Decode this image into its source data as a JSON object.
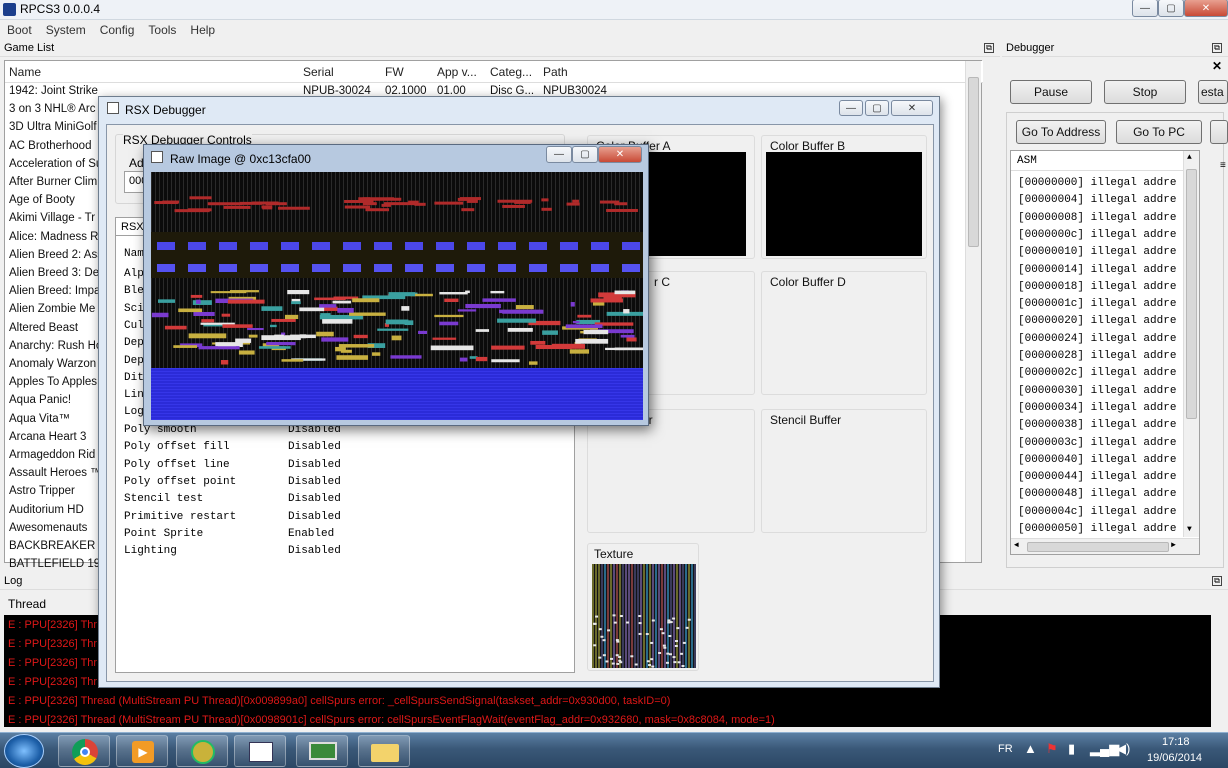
{
  "window": {
    "title": "RPCS3 0.0.0.4"
  },
  "menu": [
    "Boot",
    "System",
    "Config",
    "Tools",
    "Help"
  ],
  "game_list": {
    "title": "Game List",
    "columns": [
      "Name",
      "Serial",
      "FW",
      "App v...",
      "Categ...",
      "Path"
    ],
    "first_row": {
      "serial": "NPUB-30024",
      "fw": "02.1000",
      "app": "01.00",
      "category": "Disc G...",
      "path": "NPUB30024"
    },
    "names": [
      "1942: Joint Strike",
      "3 on 3 NHL® Arc",
      "3D Ultra MiniGolf",
      "AC Brotherhood",
      "Acceleration of Su",
      "After Burner Clim",
      "Age of Booty",
      "Akimi Village - Tr",
      "Alice: Madness R",
      "Alien Breed 2: Ass",
      "Alien Breed 3: De",
      "Alien Breed: Impa",
      "Alien Zombie Me",
      "Altered Beast",
      "Anarchy: Rush Ho",
      "Anomaly Warzon",
      "Apples To Apples",
      "Aqua Panic!",
      "Aqua Vita™",
      "Arcana Heart 3",
      "Armageddon Rid",
      "Assault Heroes ™",
      "Astro Tripper",
      "Auditorium HD",
      "Awesomenauts",
      "BACKBREAKER VE",
      "BATTLEFIELD 194"
    ]
  },
  "debugger": {
    "title": "Debugger",
    "pause": "Pause",
    "stop": "Stop",
    "third_button": "esta",
    "go_to_address": "Go To Address",
    "go_to_pc": "Go To PC",
    "asm_header": "ASM",
    "asm_lines": [
      "[00000000] illegal addre",
      "[00000004] illegal addre",
      "[00000008] illegal addre",
      "[0000000c] illegal addre",
      "[00000010] illegal addre",
      "[00000014] illegal addre",
      "[00000018] illegal addre",
      "[0000001c] illegal addre",
      "[00000020] illegal addre",
      "[00000024] illegal addre",
      "[00000028] illegal addre",
      "[0000002c] illegal addre",
      "[00000030] illegal addre",
      "[00000034] illegal addre",
      "[00000038] illegal addre",
      "[0000003c] illegal addre",
      "[00000040] illegal addre",
      "[00000044] illegal addre",
      "[00000048] illegal addre",
      "[0000004c] illegal addre",
      "[00000050] illegal addre"
    ]
  },
  "log": {
    "title": "Log",
    "column": "Thread",
    "lines": [
      "E : PPU[2326] Thr",
      "E : PPU[2326] Thr",
      "E : PPU[2326] Thr",
      "E : PPU[2326] Thr",
      "E : PPU[2326] Thread (MultiStream PU Thread)[0x009899a0]  cellSpurs error: _cellSpursSendSignal(taskset_addr=0x930d00, taskID=0)",
      "E : PPU[2326] Thread (MultiStream PU Thread)[0x0098901c]  cellSpurs error: cellSpursEventFlagWait(eventFlag_addr=0x932680, mask=0x8c8084, mode=1)"
    ]
  },
  "rsx": {
    "title": "RSX Debugger",
    "controls_label": "RSX Debugger Controls",
    "address_label": "Add",
    "address_value": "000",
    "tab_label": "RSX",
    "props_header": "Nam",
    "hidden_props": [
      "Alp",
      "Ble",
      "Sci",
      "Cul",
      "Dep",
      "Dep",
      "Dit",
      "Lin",
      "Log"
    ],
    "properties": [
      {
        "name": "Poly smooth",
        "value": "Disabled"
      },
      {
        "name": "Poly offset fill",
        "value": "Disabled"
      },
      {
        "name": "Poly offset line",
        "value": "Disabled"
      },
      {
        "name": "Poly offset point",
        "value": "Disabled"
      },
      {
        "name": "Stencil test",
        "value": "Disabled"
      },
      {
        "name": "Primitive restart",
        "value": "Disabled"
      },
      {
        "name": "Point Sprite",
        "value": "Enabled"
      },
      {
        "name": "Lighting",
        "value": "Disabled"
      }
    ],
    "buffers": {
      "a": "Color Buffer A",
      "b": "Color Buffer B",
      "c": "r C",
      "d": "Color Buffer D",
      "depth": "er",
      "stencil": "Stencil Buffer",
      "texture": "Texture"
    }
  },
  "raw_image": {
    "title": "Raw Image @ 0xc13cfa00"
  },
  "taskbar": {
    "lang": "FR",
    "time": "17:18",
    "date": "19/06/2014"
  }
}
